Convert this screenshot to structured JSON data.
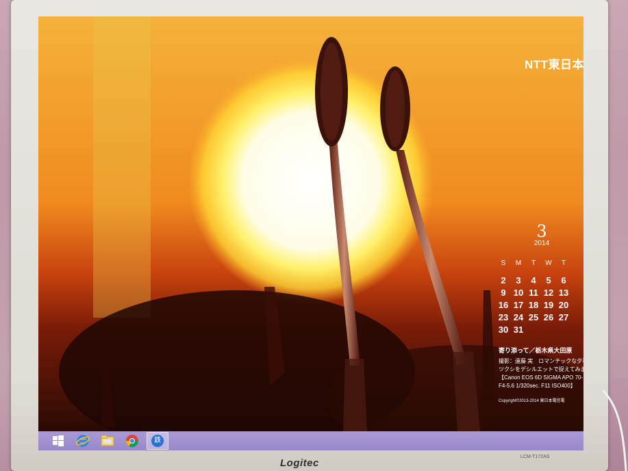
{
  "monitor": {
    "brand_logo": "Logitec",
    "model_label": "LCM-T172AS"
  },
  "wallpaper": {
    "brand": "NTT東日本",
    "calendar": {
      "month": "3",
      "year": "2014",
      "weekday_headers": [
        "S",
        "M",
        "T",
        "W",
        "T"
      ],
      "days": [
        "2",
        "3",
        "4",
        "5",
        "6",
        "9",
        "10",
        "11",
        "12",
        "13",
        "16",
        "17",
        "18",
        "19",
        "20",
        "23",
        "24",
        "25",
        "26",
        "27",
        "30",
        "31"
      ]
    },
    "caption": {
      "title": "寄り添って／栃木県大田原",
      "line1": "撮影：遠藤 実　ロマンチックな夕暮れ",
      "line2": "ツクシをデシルエットで捉えてみました",
      "line3": "【Canon EOS 6D  SIGMA APO 70-",
      "line4": "F4-5.6  1/320sec.  F11  ISO400】",
      "copyright": "Copyright©2013-2014  東日本電信電"
    }
  },
  "taskbar": {
    "items": [
      {
        "icon": "windows-start-icon"
      },
      {
        "icon": "internet-explorer-icon"
      },
      {
        "icon": "file-explorer-icon"
      },
      {
        "icon": "chrome-icon"
      },
      {
        "icon": "calendar-app-icon",
        "label": "鉄"
      }
    ],
    "color": "#9f8fd0"
  }
}
